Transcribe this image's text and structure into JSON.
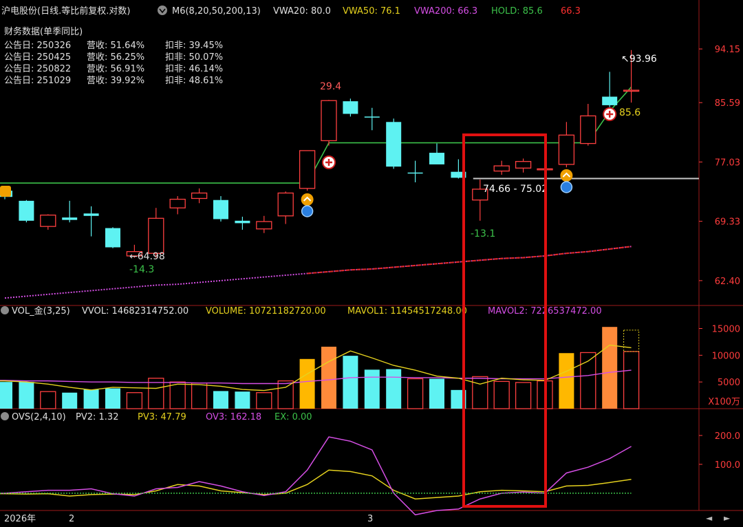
{
  "header": {
    "title": "沪电股份(日线.等比前复权.对数)",
    "indicator": "M6(8,20,50,200,13)",
    "items": [
      {
        "label": "VWA20: 80.0",
        "color": "#e0e0e0"
      },
      {
        "label": "VWA50: 76.1",
        "color": "#e6d21e"
      },
      {
        "label": "VWA200: 66.3",
        "color": "#d64fe6"
      },
      {
        "label": "HOLD: 85.6",
        "color": "#3cc24a"
      },
      {
        "label": "66.3",
        "color": "#ff3030"
      }
    ]
  },
  "financials": {
    "title": "财务数据(单季同比)",
    "rows": [
      {
        "date": "公告日: 250326",
        "rev": "营收:  51.64%",
        "net": "扣非:  39.45%"
      },
      {
        "date": "公告日: 250425",
        "rev": "营收:  56.25%",
        "net": "扣非:  50.07%"
      },
      {
        "date": "公告日: 250822",
        "rev": "营收:  56.91%",
        "net": "扣非:  46.14%"
      },
      {
        "date": "公告日: 251029",
        "rev": "营收:  39.92%",
        "net": "扣非:  48.61%"
      }
    ]
  },
  "vol_header": {
    "name": "VOL_金(3,25)",
    "items": [
      {
        "label": "VVOL: 14682314752.00",
        "color": "#e0e0e0"
      },
      {
        "label": "VOLUME: 10721182720.00",
        "color": "#e6d21e"
      },
      {
        "label": "MAVOL1: 11454517248.00",
        "color": "#e6d21e"
      },
      {
        "label": "MAVOL2: 7226537472.00",
        "color": "#d64fe6"
      }
    ]
  },
  "ovs_header": {
    "name": "OVS(2,4,10)",
    "items": [
      {
        "label": "PV2: 1.32",
        "color": "#e0e0e0"
      },
      {
        "label": "PV3: 47.79",
        "color": "#e6d21e"
      },
      {
        "label": "OV3: 162.18",
        "color": "#d64fe6"
      },
      {
        "label": "EX: 0.00",
        "color": "#3cc24a"
      }
    ]
  },
  "footer": {
    "year": "2026年",
    "months": [
      "2",
      "3"
    ]
  },
  "colors": {
    "up": "#ff4040",
    "down": "#5ef2f2",
    "vwa50": "#e6d21e",
    "vwa200": "#d64fe6",
    "hold": "#3cc24a",
    "axis": "#ff3c3c",
    "frame": "#9e1a1a"
  },
  "chart_data": [
    {
      "type": "candlestick",
      "y_scale": "log",
      "yticks": [
        94.15,
        85.59,
        77.03,
        69.33,
        62.4
      ],
      "ylim": [
        60.0,
        99.0
      ],
      "candles": [
        {
          "o": 73.2,
          "h": 73.6,
          "l": 72.1,
          "c": 72.4
        },
        {
          "o": 71.9,
          "h": 72.0,
          "l": 69.2,
          "c": 69.4
        },
        {
          "o": 68.7,
          "h": 70.2,
          "l": 68.3,
          "c": 70.1
        },
        {
          "o": 69.8,
          "h": 71.9,
          "l": 69.2,
          "c": 69.5
        },
        {
          "o": 70.3,
          "h": 71.2,
          "l": 67.5,
          "c": 70.0
        },
        {
          "o": 68.5,
          "h": 68.6,
          "l": 66.1,
          "c": 66.2
        },
        {
          "o": 65.2,
          "h": 66.5,
          "l": 64.98,
          "c": 65.7
        },
        {
          "o": 65.5,
          "h": 71.0,
          "l": 64.98,
          "c": 69.7
        },
        {
          "o": 71.0,
          "h": 72.5,
          "l": 70.2,
          "c": 72.1
        },
        {
          "o": 72.2,
          "h": 73.5,
          "l": 71.6,
          "c": 72.9
        },
        {
          "o": 72.0,
          "h": 72.5,
          "l": 69.3,
          "c": 69.6
        },
        {
          "o": 69.4,
          "h": 69.9,
          "l": 68.3,
          "c": 69.1
        },
        {
          "o": 68.4,
          "h": 70.0,
          "l": 67.9,
          "c": 69.3
        },
        {
          "o": 70.0,
          "h": 73.1,
          "l": 69.0,
          "c": 72.9
        },
        {
          "o": 73.5,
          "h": 78.6,
          "l": 73.2,
          "c": 78.6
        },
        {
          "o": 80.0,
          "h": 86.0,
          "l": 79.3,
          "c": 85.9
        },
        {
          "o": 85.8,
          "h": 86.2,
          "l": 83.5,
          "c": 83.9
        },
        {
          "o": 83.5,
          "h": 84.8,
          "l": 81.5,
          "c": 83.4
        },
        {
          "o": 82.7,
          "h": 83.2,
          "l": 76.1,
          "c": 76.4
        },
        {
          "o": 75.6,
          "h": 77.2,
          "l": 74.3,
          "c": 75.5
        },
        {
          "o": 78.3,
          "h": 79.6,
          "l": 76.8,
          "c": 76.7
        },
        {
          "o": 75.7,
          "h": 77.4,
          "l": 74.8,
          "c": 74.9
        },
        {
          "o": 72.0,
          "h": 74.66,
          "l": 69.4,
          "c": 73.4
        },
        {
          "o": 75.8,
          "h": 77.2,
          "l": 75.3,
          "c": 76.5
        },
        {
          "o": 76.2,
          "h": 77.5,
          "l": 75.6,
          "c": 77.1
        },
        {
          "o": 76.0,
          "h": 79.4,
          "l": 75.2,
          "c": 76.1
        },
        {
          "o": 76.7,
          "h": 82.7,
          "l": 76.3,
          "c": 80.8
        },
        {
          "o": 79.6,
          "h": 85.4,
          "l": 79.3,
          "c": 83.6
        },
        {
          "o": 86.5,
          "h": 90.4,
          "l": 84.9,
          "c": 85.2
        },
        {
          "o": 87.5,
          "h": 93.96,
          "l": 85.6,
          "c": 87.5
        }
      ],
      "lines": {
        "hold": [
          74.2,
          74.2,
          74.2,
          74.2,
          74.2,
          74.2,
          74.2,
          74.2,
          74.2,
          74.2,
          74.2,
          74.2,
          74.2,
          74.2,
          74.2,
          79.7,
          79.7,
          79.7,
          79.7,
          79.7,
          79.7,
          79.7,
          79.7,
          79.7,
          79.7,
          79.7,
          79.7,
          79.7,
          84.3,
          88.0
        ],
        "vwa200": [
          60.5,
          60.7,
          60.9,
          61.1,
          61.3,
          61.5,
          61.7,
          61.9,
          62.0,
          62.2,
          62.4,
          62.6,
          62.8,
          63.0,
          63.2,
          63.4,
          63.6,
          63.7,
          63.9,
          64.1,
          64.3,
          64.5,
          64.7,
          64.9,
          65.0,
          65.2,
          65.5,
          65.7,
          66.0,
          66.3
        ]
      },
      "annotations": [
        {
          "text": "29.4",
          "color": "#ff5a5a"
        },
        {
          "text": "←64.98",
          "color": "#e0e0e0"
        },
        {
          "text": "-14.3",
          "color": "#3cc24a"
        },
        {
          "text": "74.66 - 75.02",
          "color": "#ffffff"
        },
        {
          "text": "-13.1",
          "color": "#3cc24a"
        },
        {
          "text": "↖93.96",
          "color": "#ffffff"
        },
        {
          "text": "85.6",
          "color": "#e6d21e"
        }
      ]
    },
    {
      "type": "bar",
      "yticks": [
        15000,
        10000,
        5000
      ],
      "ylim": [
        0,
        17000
      ],
      "unit": "X100万",
      "values": [
        5000,
        5000,
        3200,
        3000,
        3600,
        3800,
        3000,
        5700,
        5000,
        4800,
        3300,
        3200,
        3000,
        5200,
        9300,
        11600,
        9900,
        7300,
        7400,
        5600,
        5600,
        3500,
        6000,
        5100,
        4900,
        5200,
        10400,
        10500,
        15300,
        10700
      ],
      "colors": [
        "cyan",
        "cyan",
        "red",
        "cyan",
        "cyan",
        "cyan",
        "red",
        "red",
        "red",
        "red",
        "cyan",
        "cyan",
        "red",
        "red",
        "yellow",
        "orange",
        "cyan",
        "cyan",
        "cyan",
        "red",
        "cyan",
        "cyan",
        "red",
        "red",
        "red",
        "red",
        "yellow",
        "red",
        "orange",
        "red"
      ],
      "mavol1": [
        5200,
        5000,
        4600,
        4000,
        3500,
        4000,
        3900,
        3800,
        4600,
        4500,
        4200,
        3600,
        3400,
        4000,
        6500,
        8800,
        10800,
        9500,
        8100,
        7200,
        6100,
        5700,
        4600,
        5700,
        5400,
        5300,
        7000,
        8900,
        11900,
        11400
      ],
      "mavol2": [
        5300,
        5200,
        5200,
        5100,
        5000,
        5000,
        4900,
        4900,
        4900,
        4800,
        4800,
        4700,
        4700,
        4700,
        5100,
        5400,
        5800,
        5900,
        5900,
        5800,
        5800,
        5700,
        5700,
        5600,
        5600,
        5600,
        5900,
        6200,
        6800,
        7200
      ],
      "volume_dotted": 14700
    },
    {
      "type": "line",
      "yticks": [
        200.0,
        100.0
      ],
      "ylim": [
        -60,
        250
      ],
      "series": [
        {
          "name": "PV3",
          "values": [
            -2,
            -3,
            -2,
            -10,
            -5,
            -3,
            -5,
            8,
            30,
            25,
            8,
            2,
            -5,
            0,
            30,
            80,
            75,
            60,
            10,
            -20,
            -15,
            -10,
            5,
            10,
            8,
            5,
            25,
            27,
            37,
            48
          ]
        },
        {
          "name": "OV3",
          "values": [
            0,
            5,
            10,
            10,
            15,
            -2,
            -10,
            15,
            20,
            40,
            25,
            5,
            -8,
            5,
            80,
            195,
            180,
            150,
            0,
            -75,
            -60,
            -55,
            -20,
            0,
            4,
            0,
            70,
            90,
            120,
            162
          ]
        },
        {
          "name": "EX",
          "values": [
            0,
            0,
            0,
            0,
            0,
            0,
            0,
            0,
            0,
            0,
            0,
            0,
            0,
            0,
            0,
            0,
            0,
            0,
            0,
            0,
            0,
            0,
            0,
            0,
            0,
            0,
            0,
            0,
            0,
            0
          ]
        }
      ]
    }
  ]
}
